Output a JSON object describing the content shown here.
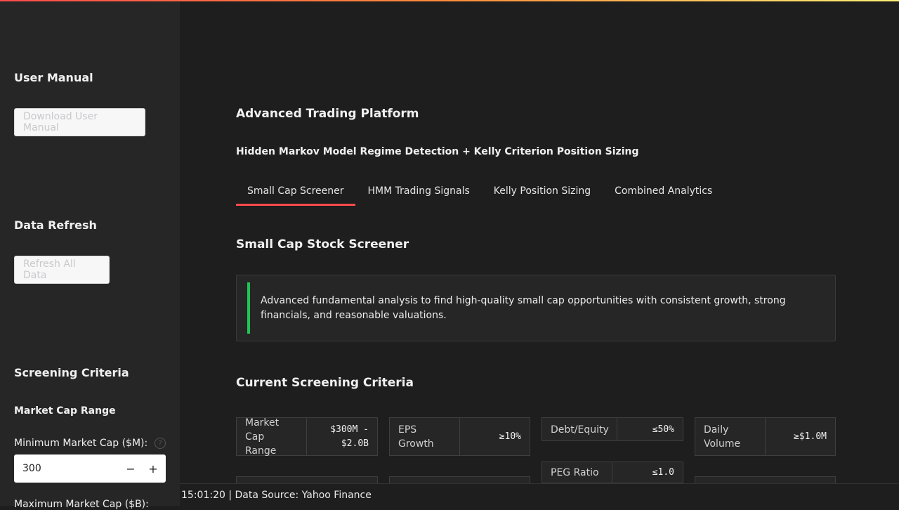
{
  "sidebar": {
    "manual_heading": "User Manual",
    "manual_button": "Download User Manual",
    "refresh_heading": "Data Refresh",
    "refresh_button": "Refresh All Data",
    "criteria_heading": "Screening Criteria",
    "market_cap_subheading": "Market Cap Range",
    "min_cap_label": "Minimum Market Cap ($M):",
    "min_cap_value": "300",
    "max_cap_label": "Maximum Market Cap ($B):"
  },
  "main": {
    "title": "Advanced Trading Platform",
    "subtitle": "Hidden Markov Model Regime Detection + Kelly Criterion Position Sizing",
    "tabs": [
      {
        "label": "Small Cap Screener"
      },
      {
        "label": "HMM Trading Signals"
      },
      {
        "label": "Kelly Position Sizing"
      },
      {
        "label": "Combined Analytics"
      }
    ],
    "section_title": "Small Cap Stock Screener",
    "info_text": "Advanced fundamental analysis to find high-quality small cap opportunities with consistent growth, strong financials, and reasonable valuations.",
    "criteria_title": "Current Screening Criteria",
    "criteria": [
      {
        "key": "Market Cap Range",
        "value": "$300M - $2.0B"
      },
      {
        "key": "EPS Growth",
        "value": "≥10%"
      },
      {
        "key": "Debt/Equity",
        "value": "≤50%"
      },
      {
        "key": "Daily Volume",
        "value": "≥$1.0M"
      },
      {
        "key": "PEG Ratio",
        "value": "≤1.0"
      }
    ]
  },
  "footer": {
    "text": "15:01:20 | Data Source: Yahoo Finance"
  },
  "colors": {
    "accent": "#ff4b4b",
    "info_bar": "#21c354",
    "background": "#1e1e1e",
    "sidebar": "#262626"
  }
}
